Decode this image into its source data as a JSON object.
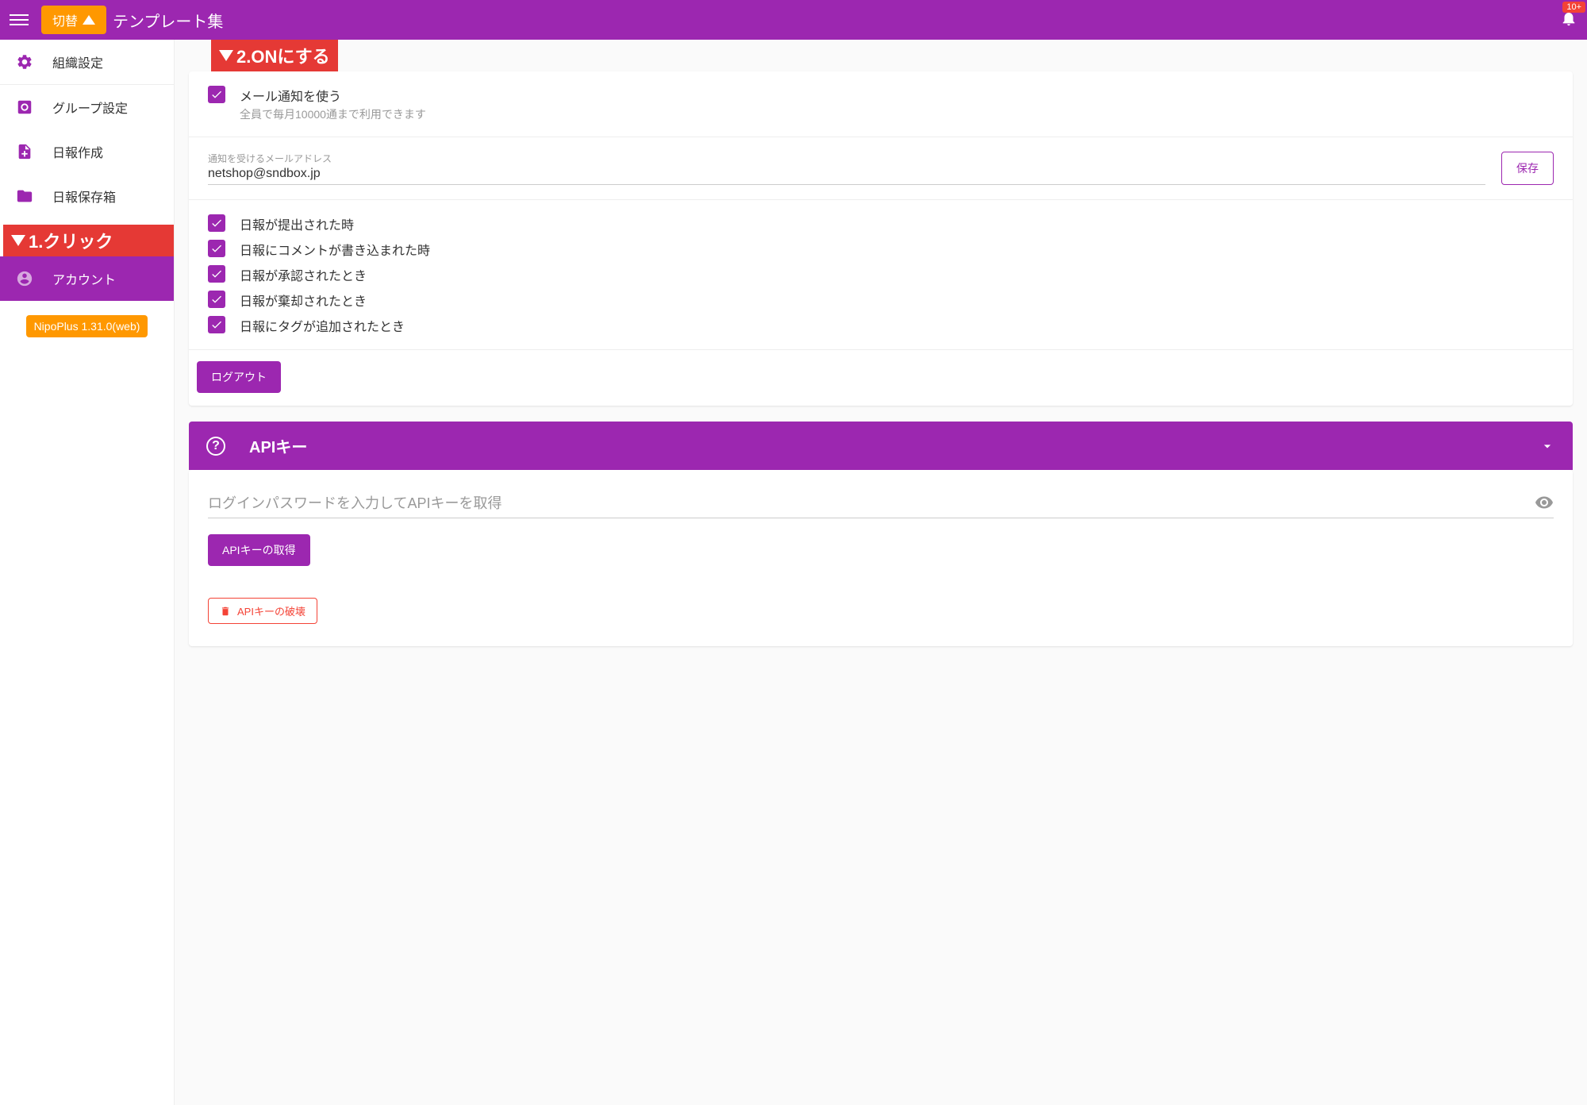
{
  "header": {
    "switch_label": "切替",
    "title": "テンプレート集",
    "notif_badge": "10+"
  },
  "annotations": {
    "top": "2.ONにする",
    "sidebar": "1.クリック"
  },
  "sidebar": {
    "items": [
      {
        "label": "組織設定"
      },
      {
        "label": "グループ設定"
      },
      {
        "label": "日報作成"
      },
      {
        "label": "日報保存箱"
      },
      {
        "label": "アカウント"
      }
    ],
    "version": "NipoPlus 1.31.0(web)"
  },
  "mail": {
    "use_label": "メール通知を使う",
    "use_sub": "全員で毎月10000通まで利用できます",
    "address_label": "通知を受けるメールアドレス",
    "address_value": "netshop@sndbox.jp",
    "save": "保存",
    "options": [
      "日報が提出された時",
      "日報にコメントが書き込まれた時",
      "日報が承認されたとき",
      "日報が棄却されたとき",
      "日報にタグが追加されたとき"
    ]
  },
  "logout": "ログアウト",
  "api": {
    "header": "APIキー",
    "placeholder": "ログインパスワードを入力してAPIキーを取得",
    "get_btn": "APIキーの取得",
    "destroy_btn": "APIキーの破壊"
  }
}
